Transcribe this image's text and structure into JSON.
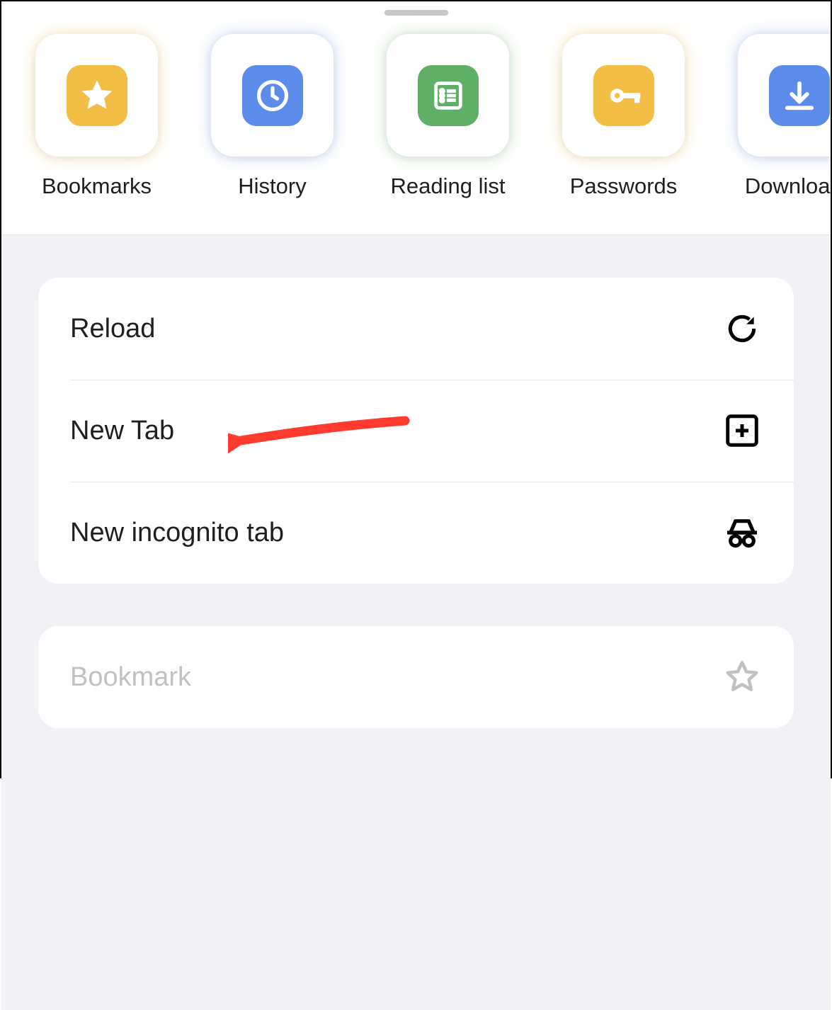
{
  "shortcuts": [
    {
      "label": "Bookmarks",
      "icon": "star-icon",
      "color": "yellow"
    },
    {
      "label": "History",
      "icon": "clock-icon",
      "color": "blue"
    },
    {
      "label": "Reading list",
      "icon": "list-icon",
      "color": "green"
    },
    {
      "label": "Passwords",
      "icon": "key-icon",
      "color": "yellow"
    },
    {
      "label": "Downloads",
      "icon": "download-icon",
      "color": "blue"
    }
  ],
  "menu_group_1": [
    {
      "label": "Reload",
      "icon": "reload-icon"
    },
    {
      "label": "New Tab",
      "icon": "plus-square-icon"
    },
    {
      "label": "New incognito tab",
      "icon": "incognito-icon"
    }
  ],
  "menu_group_2": [
    {
      "label": "Bookmark",
      "icon": "star-outline-icon",
      "disabled": true
    }
  ],
  "colors": {
    "yellow": "#f2be45",
    "blue": "#5b8ce9",
    "green": "#5faf67",
    "annotation_red": "#ff3b30"
  }
}
